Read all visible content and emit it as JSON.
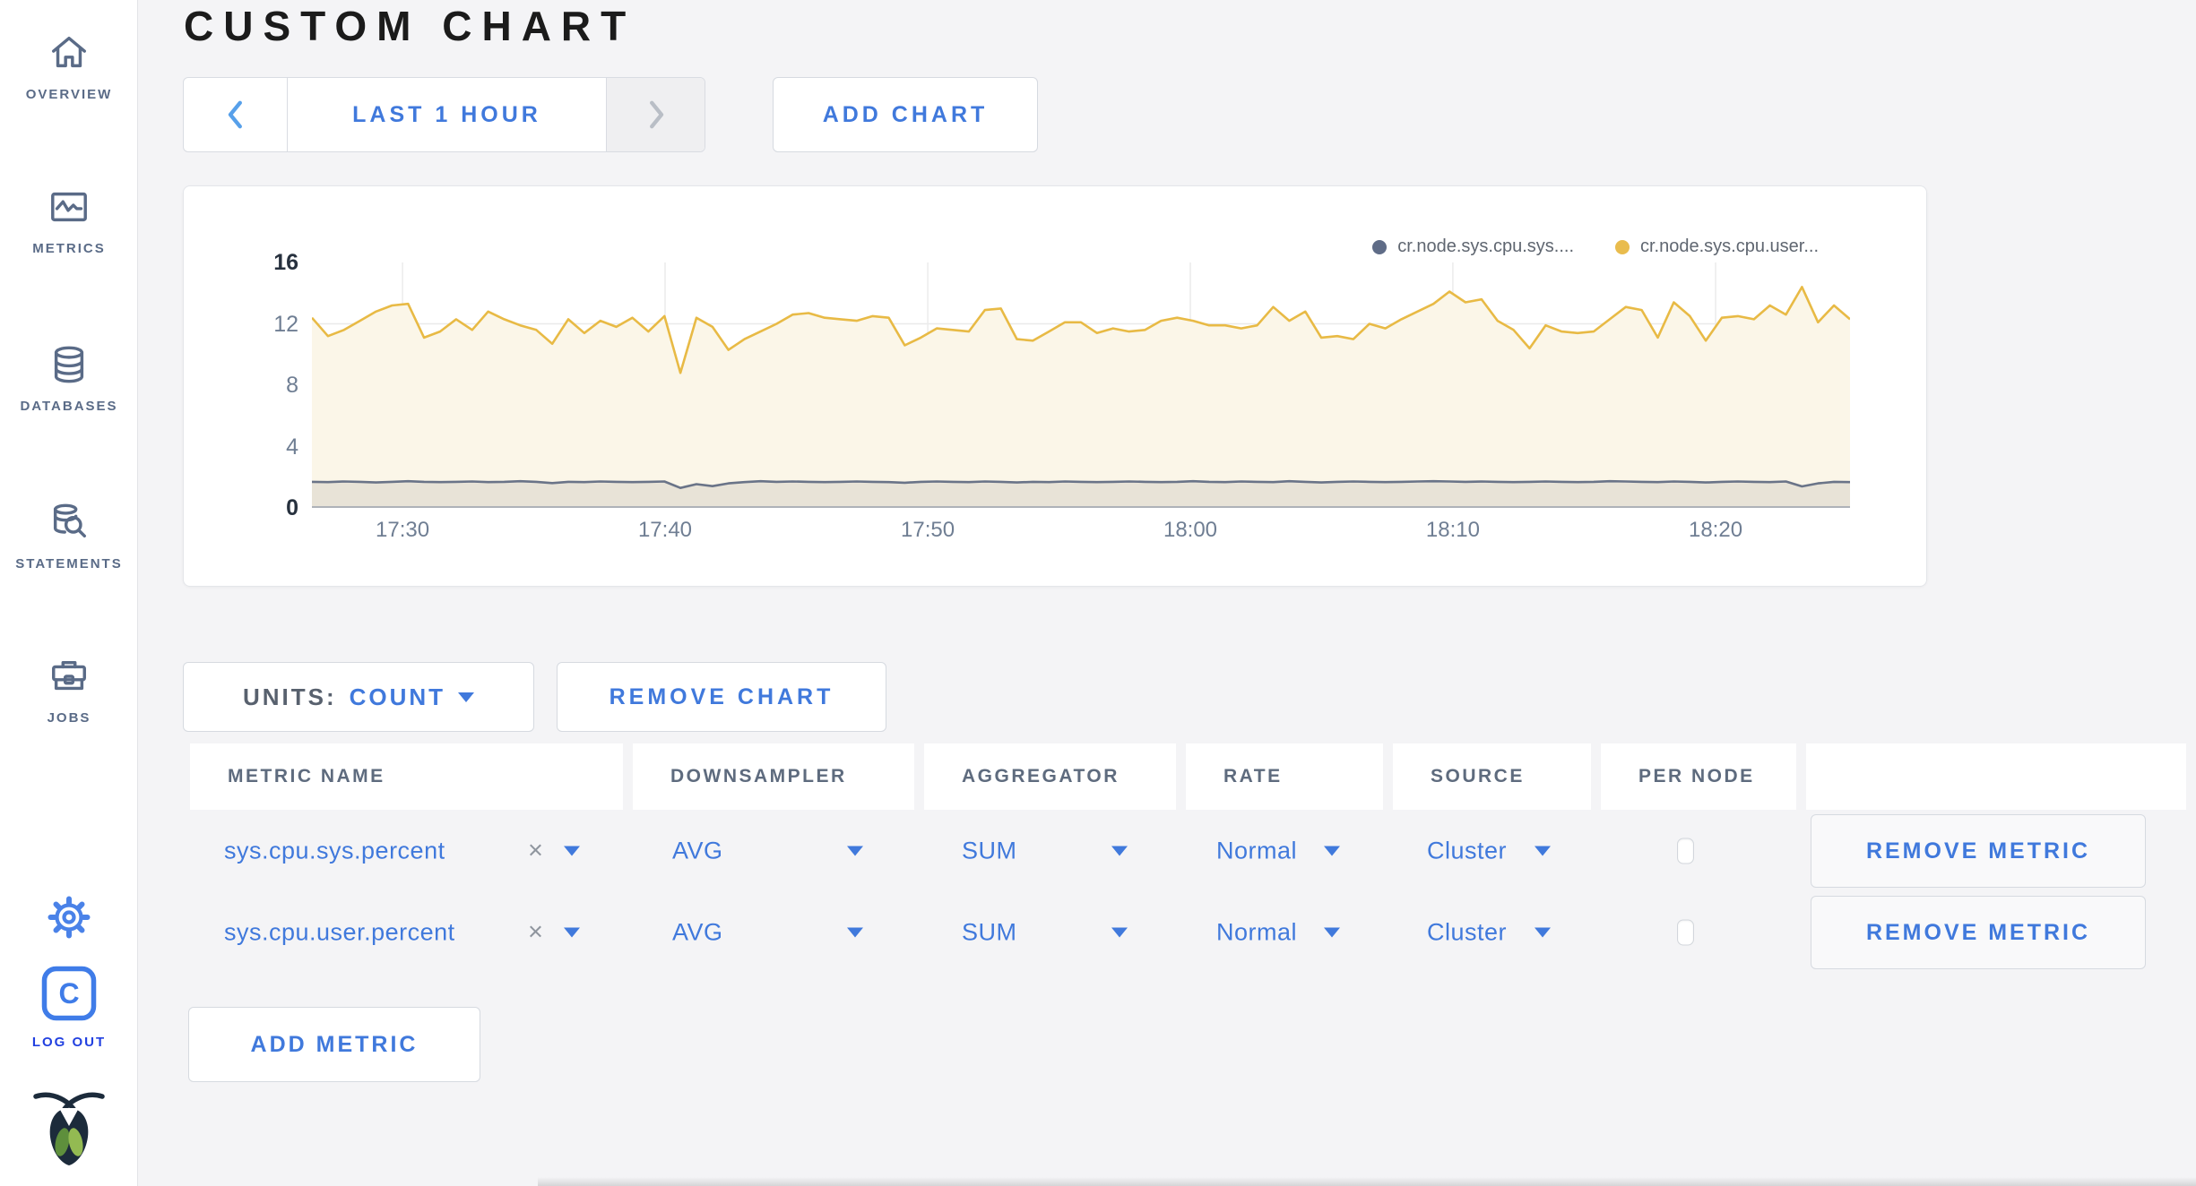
{
  "sidebar": {
    "items": [
      {
        "label": "OVERVIEW"
      },
      {
        "label": "METRICS"
      },
      {
        "label": "DATABASES"
      },
      {
        "label": "STATEMENTS"
      },
      {
        "label": "JOBS"
      }
    ],
    "logout_label": "LOG OUT"
  },
  "header": {
    "title": "CUSTOM CHART"
  },
  "toolbar": {
    "time_range": "LAST 1 HOUR",
    "add_chart": "ADD CHART"
  },
  "chart_panel": {
    "legend": [
      {
        "label": "cr.node.sys.cpu.sys....",
        "color": "#5F6C87"
      },
      {
        "label": "cr.node.sys.cpu.user...",
        "color": "#E9BC4D"
      }
    ]
  },
  "chart_data": {
    "type": "area",
    "title": "",
    "xlabel": "",
    "ylabel": "",
    "ylim": [
      0,
      16
    ],
    "y_ticks": [
      0,
      4,
      8,
      12,
      16
    ],
    "grid": true,
    "legend_position": "top-right",
    "x_ticks": [
      {
        "label": "17:30",
        "frac": 0.0589
      },
      {
        "label": "17:40",
        "frac": 0.2296
      },
      {
        "label": "17:50",
        "frac": 0.4004
      },
      {
        "label": "18:00",
        "frac": 0.5711
      },
      {
        "label": "18:10",
        "frac": 0.7418
      },
      {
        "label": "18:20",
        "frac": 0.9126
      }
    ],
    "series": [
      {
        "name": "cr.node.sys.cpu.sys.percent",
        "color": "#6A7488",
        "fill": "#E8E3D7",
        "values": [
          1.7,
          1.68,
          1.72,
          1.7,
          1.66,
          1.7,
          1.74,
          1.7,
          1.68,
          1.7,
          1.72,
          1.68,
          1.7,
          1.74,
          1.7,
          1.62,
          1.7,
          1.68,
          1.72,
          1.7,
          1.68,
          1.7,
          1.72,
          1.3,
          1.55,
          1.42,
          1.6,
          1.68,
          1.74,
          1.7,
          1.72,
          1.7,
          1.68,
          1.7,
          1.72,
          1.7,
          1.68,
          1.64,
          1.7,
          1.72,
          1.7,
          1.68,
          1.72,
          1.7,
          1.66,
          1.7,
          1.68,
          1.72,
          1.7,
          1.68,
          1.7,
          1.72,
          1.7,
          1.68,
          1.7,
          1.74,
          1.7,
          1.68,
          1.72,
          1.7,
          1.68,
          1.74,
          1.7,
          1.66,
          1.7,
          1.72,
          1.7,
          1.68,
          1.7,
          1.72,
          1.74,
          1.72,
          1.7,
          1.72,
          1.7,
          1.68,
          1.7,
          1.72,
          1.7,
          1.68,
          1.7,
          1.74,
          1.72,
          1.7,
          1.68,
          1.72,
          1.7,
          1.66,
          1.7,
          1.72,
          1.7,
          1.68,
          1.72,
          1.4,
          1.6,
          1.7,
          1.68
        ]
      },
      {
        "name": "cr.node.sys.cpu.user.percent",
        "color": "#E8BA45",
        "fill": "#FBF6E8",
        "values": [
          12.4,
          11.2,
          11.6,
          12.2,
          12.8,
          13.2,
          13.3,
          11.1,
          11.5,
          12.3,
          11.6,
          12.8,
          12.3,
          11.9,
          11.6,
          10.7,
          12.3,
          11.4,
          12.2,
          11.8,
          12.4,
          11.5,
          12.5,
          8.8,
          12.4,
          11.8,
          10.3,
          11.0,
          11.5,
          12.0,
          12.6,
          12.7,
          12.4,
          12.3,
          12.2,
          12.5,
          12.4,
          10.6,
          11.1,
          11.7,
          11.6,
          11.5,
          12.9,
          13.0,
          11.0,
          10.9,
          11.5,
          12.1,
          12.1,
          11.4,
          11.7,
          11.5,
          11.6,
          12.2,
          12.4,
          12.2,
          11.9,
          11.9,
          11.7,
          11.9,
          13.1,
          12.2,
          12.8,
          11.1,
          11.2,
          11.0,
          12.0,
          11.7,
          12.3,
          12.8,
          13.3,
          14.1,
          13.4,
          13.6,
          12.2,
          11.6,
          10.4,
          11.9,
          11.5,
          11.4,
          11.5,
          12.3,
          13.1,
          12.9,
          11.1,
          13.4,
          12.5,
          10.9,
          12.4,
          12.5,
          12.3,
          13.2,
          12.6,
          14.4,
          12.1,
          13.2,
          12.3
        ]
      }
    ]
  },
  "units_bar": {
    "units_label": "UNITS:",
    "units_value": "COUNT",
    "remove_chart": "REMOVE CHART"
  },
  "metrics_table": {
    "headers": [
      "METRIC NAME",
      "DOWNSAMPLER",
      "AGGREGATOR",
      "RATE",
      "SOURCE",
      "PER NODE",
      ""
    ],
    "rows": [
      {
        "metric": "sys.cpu.sys.percent",
        "clear": "×",
        "downsampler": "AVG",
        "aggregator": "SUM",
        "rate": "Normal",
        "source": "Cluster",
        "per_node_checked": false,
        "remove_label": "REMOVE METRIC"
      },
      {
        "metric": "sys.cpu.user.percent",
        "clear": "×",
        "downsampler": "AVG",
        "aggregator": "SUM",
        "rate": "Normal",
        "source": "Cluster",
        "per_node_checked": false,
        "remove_label": "REMOVE METRIC"
      }
    ],
    "add_metric": "ADD METRIC"
  },
  "colors": {
    "accent_blue": "#4079DC",
    "logout_blue": "#2140E0",
    "icon_blue": "#4A82E8",
    "sidebar_slate": "#5A6B87",
    "page_bg": "#F4F4F6",
    "grid": "#EAEAEA",
    "axis_dark": "#27313E",
    "axis_gray": "#6F7E93"
  }
}
